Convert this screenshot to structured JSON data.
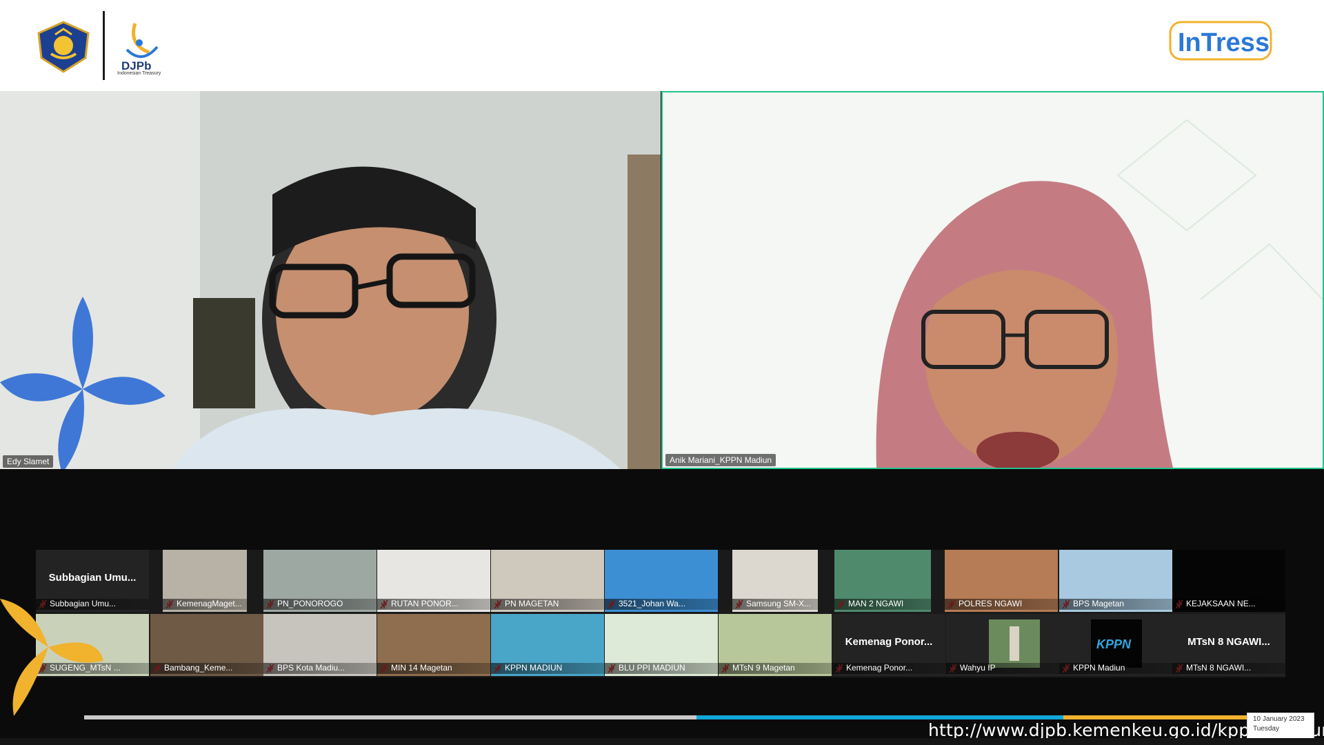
{
  "header": {
    "djpb_text": "DJPb",
    "djpb_sub": "Indonesian Treasury",
    "intress_text": "InTress"
  },
  "main_tiles": {
    "left_name": "Edy Slamet",
    "right_name": "Anik Mariani_KPPN Madiun"
  },
  "participants": [
    {
      "label": "Subbagian Umu...",
      "big": "Subbagian Umu..."
    },
    {
      "label": "KemenagMaget..."
    },
    {
      "label": "PN_PONOROGO"
    },
    {
      "label": "RUTAN PONOR..."
    },
    {
      "label": "PN MAGETAN"
    },
    {
      "label": "3521_Johan Wa..."
    },
    {
      "label": "Samsung SM-X..."
    },
    {
      "label": "MAN 2 NGAWI"
    },
    {
      "label": "POLRES NGAWI"
    },
    {
      "label": "BPS Magetan"
    },
    {
      "label": "KEJAKSAAN NE..."
    },
    {
      "label": "SUGENG_MTsN ..."
    },
    {
      "label": "Bambang_Keme..."
    },
    {
      "label": "BPS Kota Madiu..."
    },
    {
      "label": "MIN 14 Magetan"
    },
    {
      "label": "KPPN MADIUN"
    },
    {
      "label": "BLU PPI MADIUN"
    },
    {
      "label": "MTsN 9 Magetan"
    },
    {
      "label": "Kemenag Ponor...",
      "big": "Kemenag Ponor..."
    },
    {
      "label": "Wahyu IP"
    },
    {
      "label": "KPPN Madiun"
    },
    {
      "label": "MTsN 8 NGAWI...",
      "big": "MTsN 8 NGAWI..."
    }
  ],
  "footer": {
    "url": "http://www.djpb.kemenkeu.go.id/kppn/madiun",
    "date_line1": "10 January 2023",
    "date_line2": "Tuesday"
  },
  "colors": {
    "accent_green": "#22c38e",
    "blue": "#12a6d9",
    "yellow": "#f1b22e",
    "brand_blue": "#2b78d6"
  }
}
